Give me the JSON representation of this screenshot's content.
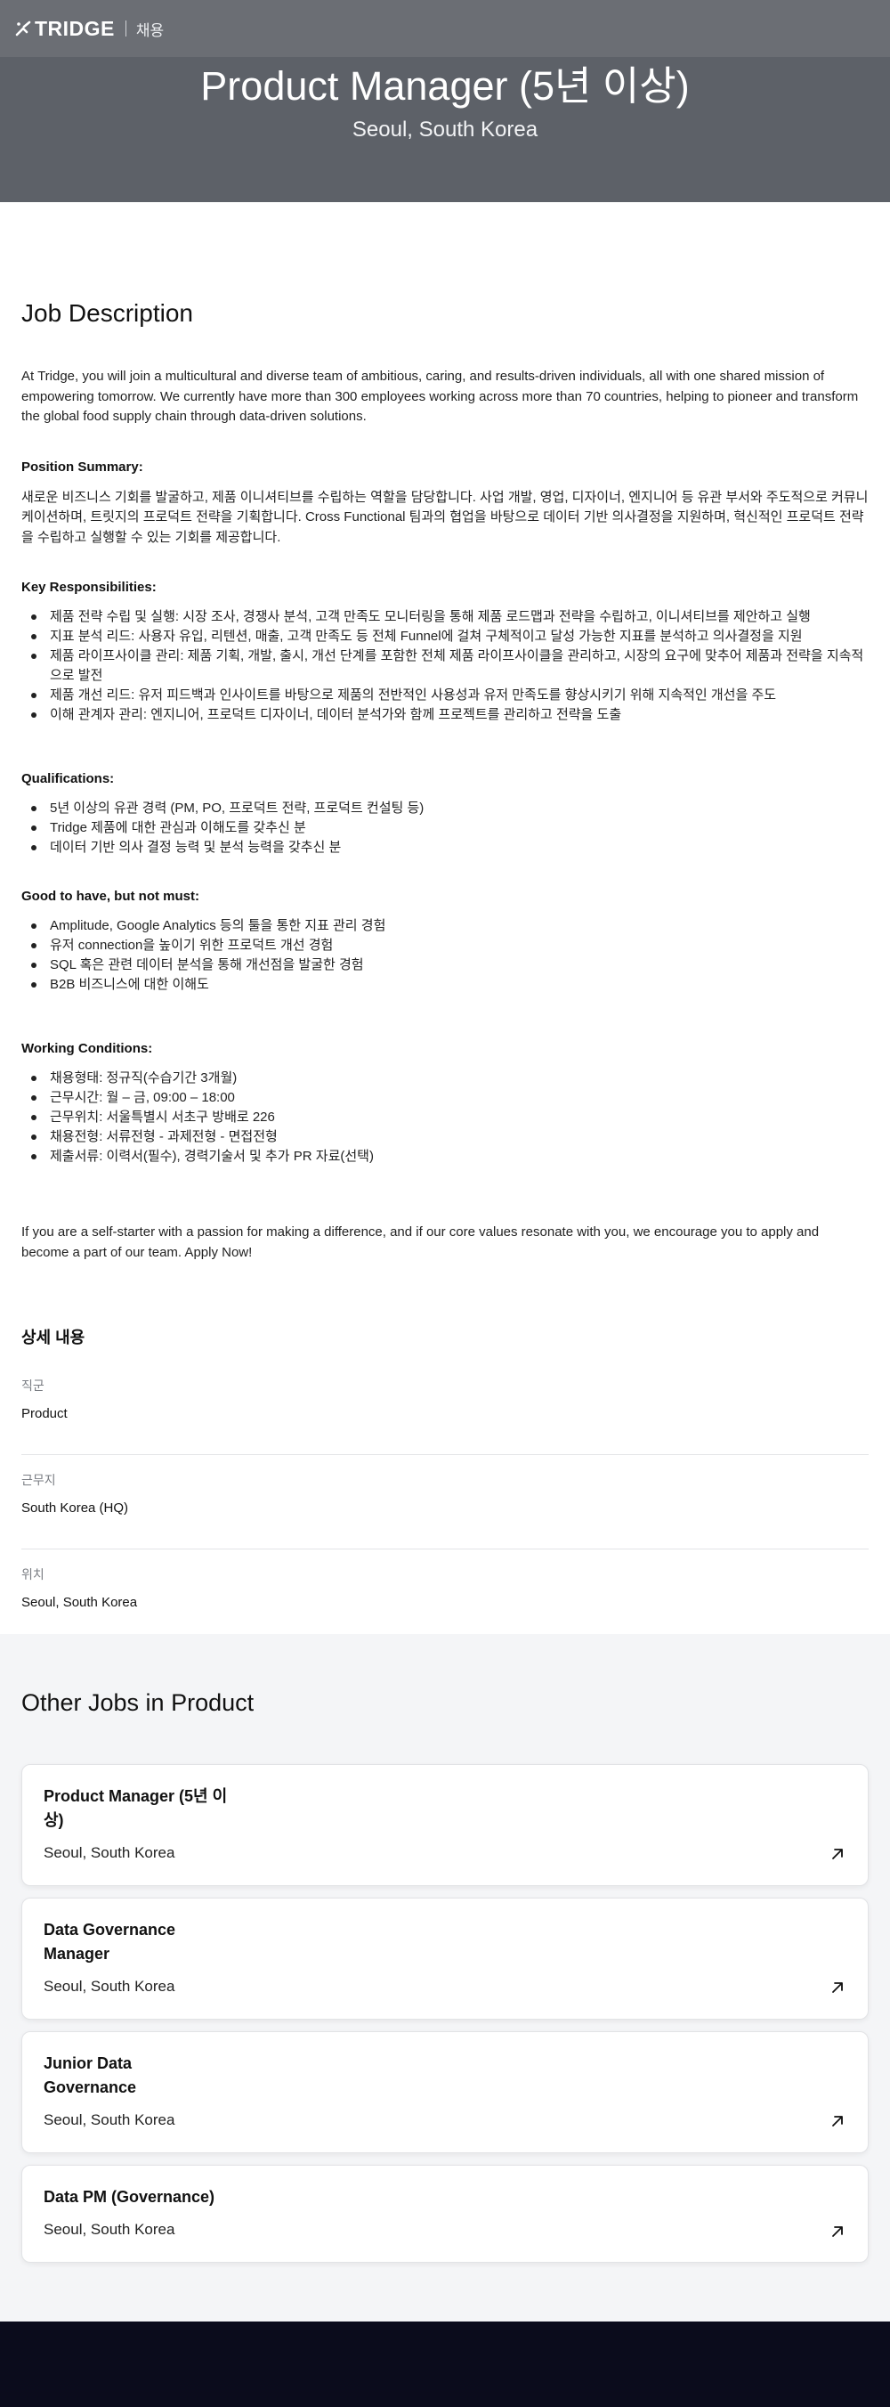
{
  "brand": {
    "name": "TRIDGE",
    "section": "채용"
  },
  "hero": {
    "title": "Product Manager (5년 이상)",
    "location": "Seoul, South Korea"
  },
  "job_description": {
    "heading": "Job Description",
    "intro": "At Tridge, you will join a multicultural and diverse team of ambitious, caring, and results-driven individuals, all with one shared mission of empowering tomorrow. We currently have more than 300 employees working across more than 70 countries, helping to pioneer and transform the global food supply chain through data-driven solutions.",
    "position_summary": {
      "title": "Position Summary:",
      "text": "새로운 비즈니스 기회를 발굴하고, 제품 이니셔티브를 수립하는 역할을 담당합니다. 사업 개발, 영업, 디자이너, 엔지니어 등 유관 부서와 주도적으로 커뮤니케이션하며, 트릿지의 프로덕트 전략을 기획합니다. Cross Functional 팀과의 협업을 바탕으로 데이터 기반 의사결정을 지원하며, 혁신적인 프로덕트 전략을 수립하고 실행할 수 있는 기회를 제공합니다."
    },
    "responsibilities": {
      "title": "Key Responsibilities:",
      "items": [
        "제품 전략 수립 및 실행: 시장 조사, 경쟁사 분석, 고객 만족도 모니터링을 통해 제품 로드맵과 전략을 수립하고, 이니셔티브를 제안하고 실행",
        "지표 분석 리드: 사용자 유입, 리텐션, 매출, 고객 만족도 등 전체 Funnel에 걸쳐 구체적이고 달성 가능한 지표를 분석하고 의사결정을 지원",
        "제품 라이프사이클 관리: 제품 기획, 개발, 출시, 개선 단계를 포함한 전체 제품 라이프사이클을 관리하고, 시장의 요구에 맞추어 제품과 전략을 지속적으로 발전",
        "제품 개선 리드: 유저 피드백과 인사이트를 바탕으로 제품의 전반적인 사용성과 유저 만족도를 향상시키기 위해 지속적인 개선을 주도",
        "이해 관계자 관리: 엔지니어, 프로덕트 디자이너, 데이터 분석가와 함께 프로젝트를 관리하고 전략을 도출"
      ]
    },
    "qualifications": {
      "title": "Qualifications:",
      "items": [
        "5년 이상의 유관 경력 (PM, PO, 프로덕트 전략, 프로덕트 컨설팅 등)",
        "Tridge 제품에 대한 관심과 이해도를 갖추신 분",
        "데이터 기반 의사 결정 능력 및 분석 능력을 갖추신 분"
      ]
    },
    "good_to_have": {
      "title": "Good to have, but not must:",
      "items": [
        "Amplitude, Google Analytics 등의 툴을 통한 지표 관리 경험",
        "유저 connection을 높이기 위한 프로덕트 개선 경험",
        "SQL 혹은 관련 데이터 분석을 통해 개선점을 발굴한 경험",
        "B2B 비즈니스에 대한 이해도"
      ]
    },
    "working_conditions": {
      "title": "Working Conditions:",
      "items": [
        "채용형태: 정규직(수습기간 3개월)",
        "근무시간: 월 – 금, 09:00 – 18:00",
        "근무위치: 서울특별시 서초구 방배로 226",
        "채용전형: 서류전형 - 과제전형 - 면접전형",
        "제출서류: 이력서(필수), 경력기술서 및 추가 PR 자료(선택)"
      ]
    },
    "closing": "If you are a self-starter with a passion for making a difference, and if our core values resonate with you, we encourage you to apply and become a part of our team. Apply Now!"
  },
  "details": {
    "heading": "상세 내용",
    "items": [
      {
        "label": "직군",
        "value": "Product"
      },
      {
        "label": "근무지",
        "value": "South Korea (HQ)"
      },
      {
        "label": "위치",
        "value": "Seoul, South Korea"
      }
    ]
  },
  "other_jobs": {
    "heading": "Other Jobs in Product",
    "jobs": [
      {
        "title": "Product Manager (5년 이상)",
        "location": "Seoul, South Korea"
      },
      {
        "title": "Data Governance Manager",
        "location": "Seoul, South Korea"
      },
      {
        "title": "Junior Data Governance",
        "location": "Seoul, South Korea"
      },
      {
        "title": "Data PM (Governance)",
        "location": "Seoul, South Korea"
      }
    ]
  },
  "icons": {
    "logo": "tridge-logo-icon",
    "open": "arrow-up-right-icon"
  }
}
